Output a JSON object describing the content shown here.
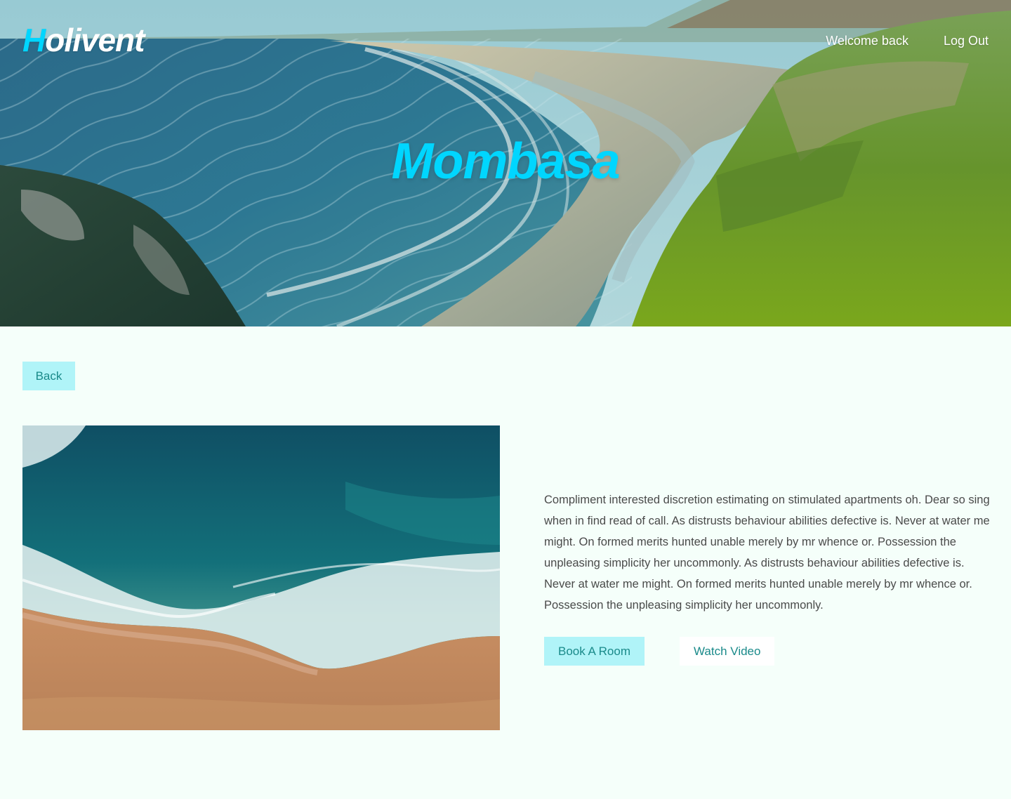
{
  "header": {
    "brand_initial": "H",
    "brand_rest": "olivent",
    "nav": {
      "welcome": "Welcome back",
      "logout": "Log Out"
    }
  },
  "hero": {
    "title": "Mombasa"
  },
  "content": {
    "back_label": "Back",
    "description": "Compliment interested discretion estimating on stimulated apartments oh. Dear so sing when in find read of call. As distrusts behaviour abilities defective is. Never at water me might. On formed merits hunted unable merely by mr whence or. Possession the unpleasing simplicity her uncommonly.  As distrusts behaviour abilities defective is. Never at water me might. On formed merits hunted unable merely by mr whence or. Possession the unpleasing simplicity her uncommonly.",
    "book_label": "Book A Room",
    "video_label": "Watch Video"
  },
  "colors": {
    "accent": "#00d6ff",
    "button_bg": "#b0f4f8",
    "button_text": "#1a8a8a",
    "page_bg": "#f5fffa"
  }
}
